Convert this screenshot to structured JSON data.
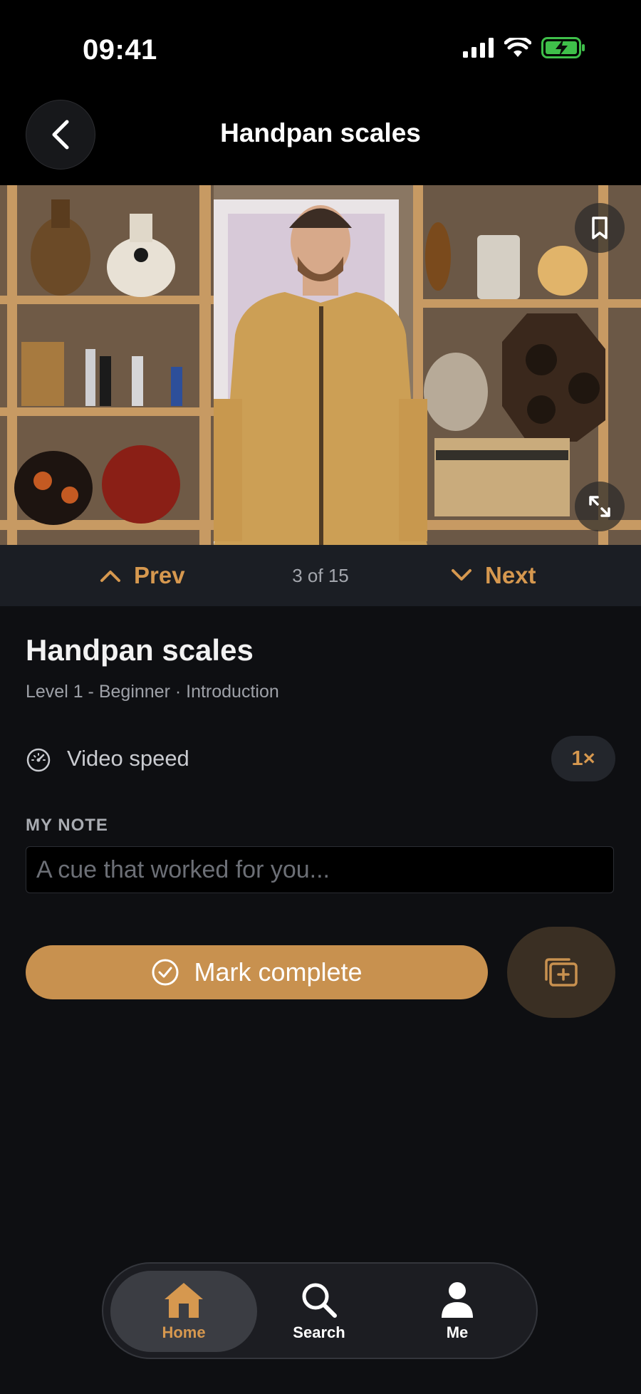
{
  "status_bar": {
    "time": "09:41"
  },
  "nav": {
    "title": "Handpan scales"
  },
  "pager": {
    "prev_label": "Prev",
    "next_label": "Next",
    "counter": "3 of 15"
  },
  "lesson": {
    "title": "Handpan scales",
    "subtitle": "Level 1 - Beginner · Introduction",
    "speed_label": "Video speed",
    "speed_value": "1×",
    "note_label": "MY NOTE",
    "note_placeholder": "A cue that worked for you...",
    "note_value": "",
    "complete_label": "Mark complete"
  },
  "tabs": [
    {
      "label": "Home",
      "icon": "home-icon",
      "active": true
    },
    {
      "label": "Search",
      "icon": "search-icon",
      "active": false
    },
    {
      "label": "Me",
      "icon": "person-icon",
      "active": false
    }
  ],
  "colors": {
    "accent": "#d6984f",
    "button": "#c8914f",
    "background": "#0e0f12"
  }
}
